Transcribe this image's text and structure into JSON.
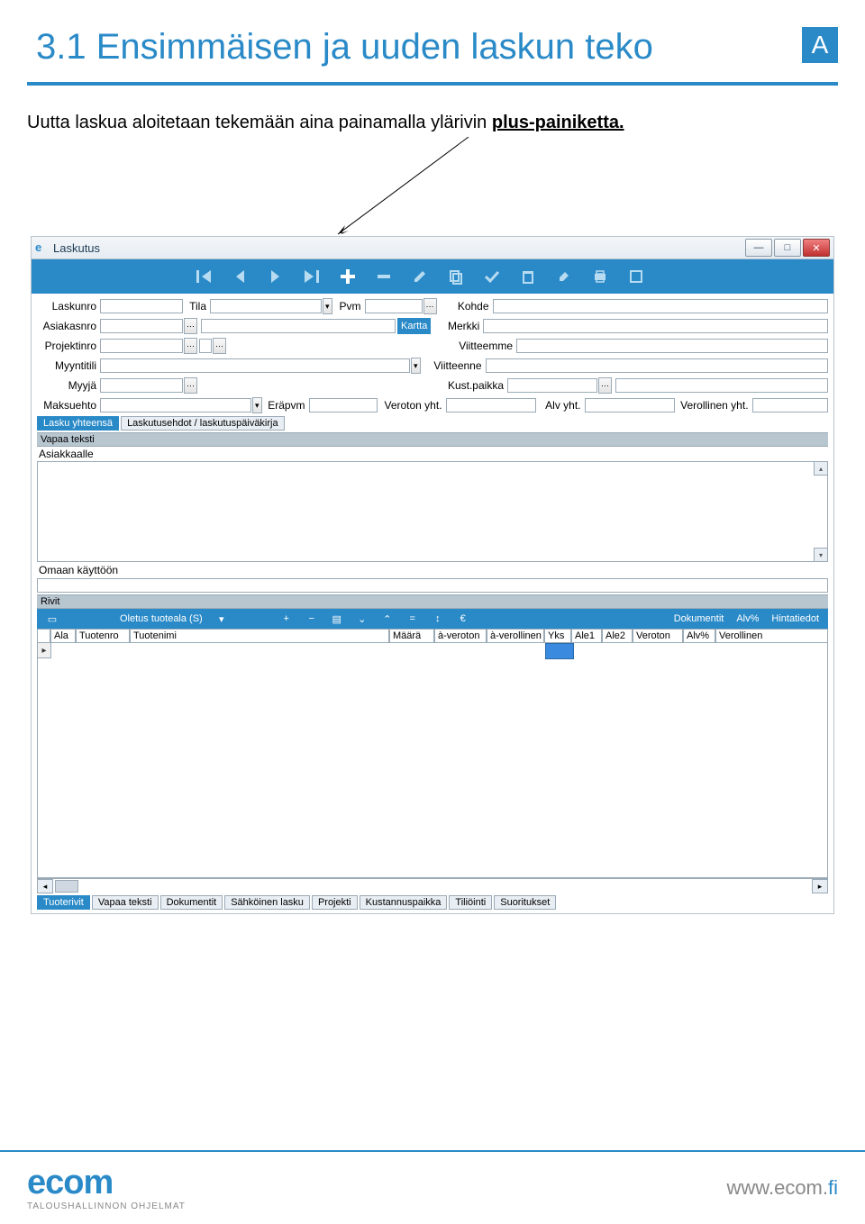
{
  "page": {
    "title": "3.1 Ensimmäisen ja uuden laskun teko",
    "badge": "A",
    "body_prefix": "Uutta laskua aloitetaan tekemään aina painamalla ylärivin ",
    "body_underline": "plus-painiketta.",
    "footer_logo": "ecom",
    "footer_sub": "TALOUSHALLINNON OHJELMAT",
    "footer_url_prefix": "www.ecom.",
    "footer_url_suffix": "fi"
  },
  "app": {
    "title": "Laskutus",
    "winbtns": {
      "min": "—",
      "max": "□",
      "close": "✕"
    },
    "form": {
      "labels": {
        "laskunro": "Laskunro",
        "tila": "Tila",
        "pvm": "Pvm",
        "kohde": "Kohde",
        "asiakasnro": "Asiakasnro",
        "kartta": "Kartta",
        "merkki": "Merkki",
        "projektinro": "Projektinro",
        "viitteemme": "Viitteemme",
        "myyntitili": "Myyntitili",
        "viitteenne": "Viitteenne",
        "myyja": "Myyjä",
        "kustpaikka": "Kust.paikka",
        "maksuehto": "Maksuehto",
        "erapvm": "Eräpvm",
        "veroton_yht": "Veroton yht.",
        "alv_yht": "Alv yht.",
        "verollinen_yht": "Verollinen yht."
      }
    },
    "tabs1": [
      "Lasku yhteensä",
      "Laskutusehdot / laskutuspäiväkirja"
    ],
    "section_vapaa": "Vapaa teksti",
    "section_asiakkaalle": "Asiakkaalle",
    "section_omaan": "Omaan käyttöön",
    "section_rivit": "Rivit",
    "rowtoolbar": {
      "oletus": "Oletus tuoteala (S)",
      "dokumentit": "Dokumentit",
      "alvp": "Alv%",
      "hintatiedot": "Hintatiedot"
    },
    "grid_cols": [
      "Ala",
      "Tuotenro",
      "Tuotenimi",
      "Määrä",
      "à-veroton",
      "à-verollinen",
      "Yks",
      "Ale1",
      "Ale2",
      "Veroton",
      "Alv%",
      "Verollinen"
    ],
    "tabs2": [
      "Tuoterivit",
      "Vapaa teksti",
      "Dokumentit",
      "Sähköinen lasku",
      "Projekti",
      "Kustannuspaikka",
      "Tiliöinti",
      "Suoritukset"
    ]
  }
}
